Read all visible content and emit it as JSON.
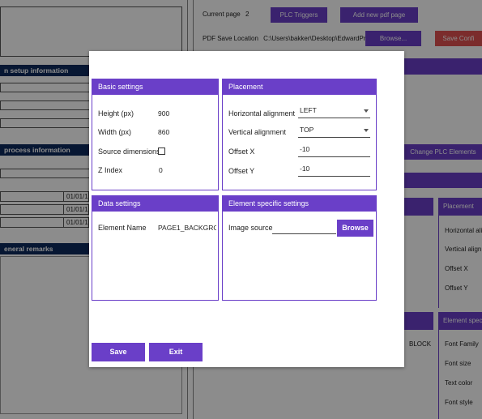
{
  "background": {
    "left": {
      "header_setup": "n setup information",
      "header_process": "process information",
      "header_remarks": "eneral remarks",
      "dates": [
        "01/01/1",
        "01/01/1",
        "01/01/1"
      ]
    },
    "toolbar": {
      "current_page_label": "Current page",
      "current_page_value": "2",
      "plc_triggers": "PLC Triggers",
      "add_pdf_page": "Add new pdf page",
      "pdf_location_label": "PDF Save Location",
      "pdf_location_value": "C:\\Users\\bakker\\Desktop\\EdwardProj",
      "browse": "Browse...",
      "save_config": "Save Confi",
      "change_plc": "Change PLC Elements"
    },
    "side": {
      "placement_header": "Placement",
      "horizontal": "Horizontal ali",
      "vertical": "Vertical align",
      "offset_x": "Offset X",
      "offset_y": "Offset Y",
      "element_spec_header": "Element speci",
      "font_family": "Font Family",
      "font_size": "Font size",
      "text_color": "Text color",
      "font_style": "Font style",
      "block_text": "BLOCK"
    }
  },
  "dialog": {
    "basic": {
      "title": "Basic settings",
      "height_label": "Height (px)",
      "height_value": "900",
      "width_label": "Width (px)",
      "width_value": "860",
      "source_dims_label": "Source dimensions",
      "source_dims_checked": false,
      "zindex_label": "Z Index",
      "zindex_value": "0"
    },
    "placement": {
      "title": "Placement",
      "halign_label": "Horizontal alignment",
      "halign_value": "LEFT",
      "valign_label": "Vertical alignment",
      "valign_value": "TOP",
      "offset_x_label": "Offset X",
      "offset_x_value": "-10",
      "offset_y_label": "Offset Y",
      "offset_y_value": "-10"
    },
    "data": {
      "title": "Data settings",
      "element_name_label": "Element Name",
      "element_name_value": "PAGE1_BACKGROL"
    },
    "element_specific": {
      "title": "Element specific settings",
      "image_source_label": "Image source",
      "image_source_value": "",
      "browse_label": "Browse"
    },
    "save_label": "Save",
    "exit_label": "Exit"
  },
  "colors": {
    "accent": "#6a3fc8",
    "dark_header": "#0d2a5e",
    "save_config": "#e05050"
  }
}
